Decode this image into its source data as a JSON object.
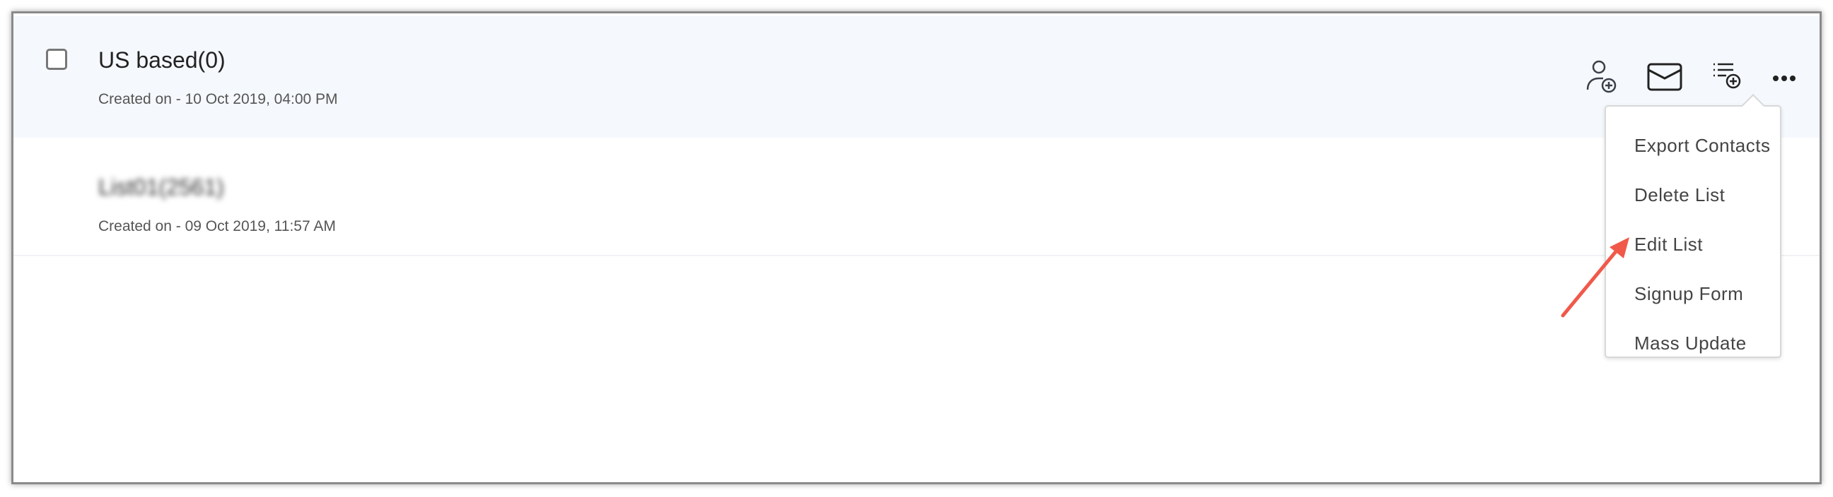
{
  "lists": [
    {
      "name": "US based(0)",
      "created": "Created on - 10 Oct 2019, 04:00 PM",
      "selected": false
    },
    {
      "name": "List01(2561)",
      "created": "Created on - 09 Oct 2019, 11:57 AM"
    }
  ],
  "actions": [
    {
      "icon": "add-contact-icon"
    },
    {
      "icon": "mail-icon"
    },
    {
      "icon": "add-to-list-icon"
    },
    {
      "icon": "more-options-icon"
    }
  ],
  "menu": {
    "items": [
      "Export Contacts",
      "Delete List",
      "Edit List",
      "Signup Form",
      "Mass Update"
    ]
  },
  "annotation": {
    "arrow_color": "#f0594a",
    "points_to": "Edit List"
  }
}
